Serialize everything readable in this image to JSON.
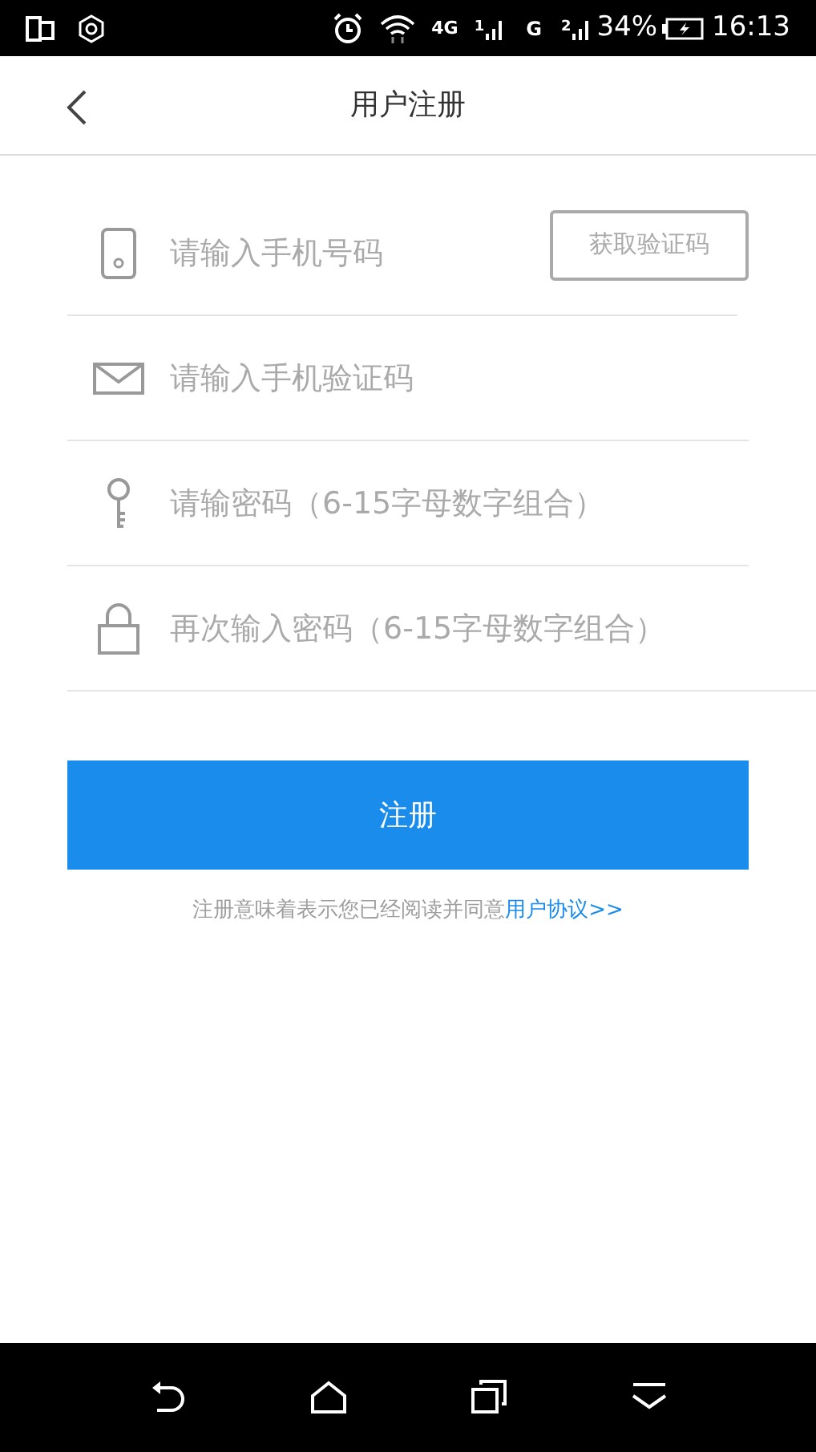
{
  "status_bar": {
    "network": "4G",
    "sim1": "1",
    "network_2": "G",
    "sim2": "2",
    "battery": "34%",
    "time": "16:13"
  },
  "header": {
    "title": "用户注册"
  },
  "fields": [
    {
      "kind": "phone",
      "placeholder": "请输入手机号码",
      "button": "获取验证码"
    },
    {
      "kind": "mail",
      "placeholder": "请输入手机验证码"
    },
    {
      "kind": "key",
      "placeholder": "请输密码（6-15字母数字组合）"
    },
    {
      "kind": "lock",
      "placeholder": "再次输入密码（6-15字母数字组合）"
    }
  ],
  "submit": "注册",
  "agreement": {
    "text": "注册意味着表示您已经阅读并同意",
    "link": "用户协议>>"
  }
}
